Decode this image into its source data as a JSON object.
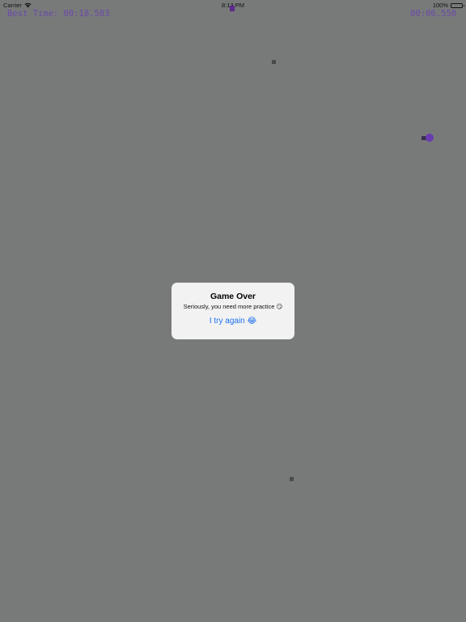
{
  "status_bar": {
    "carrier": "Carrier",
    "time": "8:13 PM",
    "battery": "100%"
  },
  "hud": {
    "best_time_label": "Best Time:",
    "best_time_value": "00:18.583",
    "current_time": "00:06.550"
  },
  "alert": {
    "title": "Game Over",
    "message": "Seriously, you need more practice 😏",
    "button_label": "I try again 😂"
  },
  "colors": {
    "background": "#787a7a",
    "hud_text": "#6a4aa8",
    "player": "#6a3ab0",
    "enemy": "#4a4a4a",
    "button": "#1d6ff0"
  }
}
